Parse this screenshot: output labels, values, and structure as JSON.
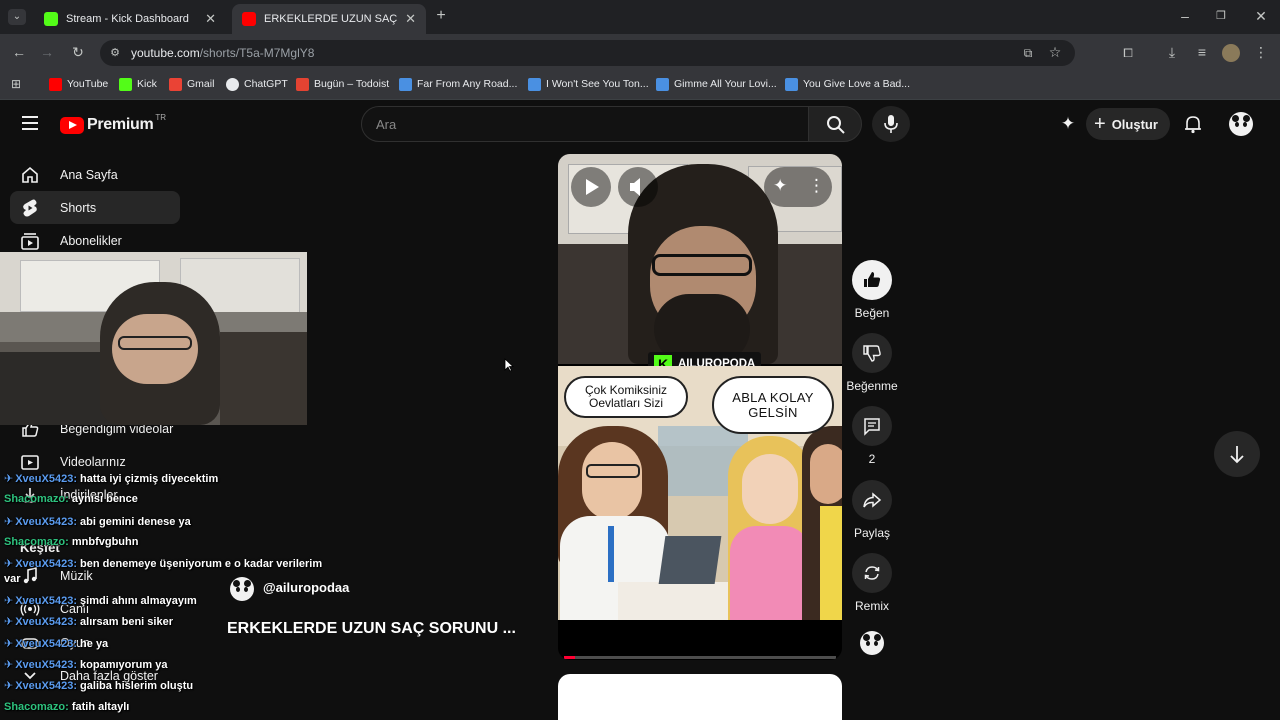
{
  "browser": {
    "tabs": [
      {
        "title": "Stream - Kick Dashboard",
        "favicon_color": "#53fc18"
      },
      {
        "title": "ERKEKLERDE UZUN SAÇ SORUN",
        "favicon_color": "#ff0000"
      }
    ],
    "url": {
      "host": "youtube.com",
      "path": "/shorts/T5a-M7MglY8"
    },
    "bookmarks": [
      {
        "label": "YouTube",
        "color": "#ff0000"
      },
      {
        "label": "Kick",
        "color": "#53fc18"
      },
      {
        "label": "Gmail",
        "color": "#ea4335"
      },
      {
        "label": "ChatGPT",
        "color": "#e8eaed"
      },
      {
        "label": "Bugün – Todoist",
        "color": "#e44332"
      },
      {
        "label": "Far From Any Road...",
        "color": "#4a90e2"
      },
      {
        "label": "I Won't See You Ton...",
        "color": "#4a90e2"
      },
      {
        "label": "Gimme All Your Lovi...",
        "color": "#4a90e2"
      },
      {
        "label": "You Give Love a Bad...",
        "color": "#4a90e2"
      }
    ]
  },
  "youtube": {
    "logo": "Premium",
    "logo_region": "TR",
    "search_placeholder": "Ara",
    "create_label": "Oluştur",
    "sidebar": [
      {
        "label": "Ana Sayfa",
        "icon": "home-icon"
      },
      {
        "label": "Shorts",
        "icon": "shorts-icon"
      },
      {
        "label": "Abonelikler",
        "icon": "subscriptions-icon"
      },
      {
        "label": "Beğendiğim videolar",
        "icon": "like-icon"
      },
      {
        "label": "Videolarınız",
        "icon": "your-videos-icon"
      },
      {
        "label": "İndirilenler",
        "icon": "download-icon"
      },
      {
        "label": "Keşfet",
        "icon": "explore-icon"
      },
      {
        "label": "Müzik",
        "icon": "music-icon"
      },
      {
        "label": "Canlı",
        "icon": "live-icon"
      },
      {
        "label": "Oyun",
        "icon": "gaming-icon"
      },
      {
        "label": "Daha fazla göster",
        "icon": "chevron-down-icon"
      }
    ],
    "short": {
      "channel": "@ailuropodaa",
      "title": "ERKEKLERDE UZUN SAÇ SORUNU ...",
      "overlay_brand": "AILUROPODA",
      "bubble_left": "Çok Komiksiniz Oevlatları Sizi",
      "bubble_right": "ABLA KOLAY GELSİN"
    },
    "actions": {
      "like": "Beğen",
      "dislike": "Beğenme",
      "comments": "2",
      "share": "Paylaş",
      "remix": "Remix"
    }
  },
  "chat": [
    {
      "user": "XveuX5423:",
      "msg": "hatta iyi çizmiş diyecektim",
      "kind": "u1"
    },
    {
      "user": "Shacomazo:",
      "msg": "aynısı bence",
      "kind": "u2"
    },
    {
      "user": "XveuX5423:",
      "msg": "abi gemini denese ya",
      "kind": "u1"
    },
    {
      "user": "Shacomazo:",
      "msg": "mnbfvgbuhn",
      "kind": "u2"
    },
    {
      "user": "XveuX5423:",
      "msg": "ben denemeye üşeniyorum e o kadar verilerim",
      "kind": "u1"
    },
    {
      "user": "",
      "msg": "var",
      "kind": "cont"
    },
    {
      "user": "XveuX5423:",
      "msg": "şimdi ahını almayayım",
      "kind": "u1"
    },
    {
      "user": "XveuX5423:",
      "msg": "alırsam beni siker",
      "kind": "u1"
    },
    {
      "user": "XveuX5423:",
      "msg": "he ya",
      "kind": "u1"
    },
    {
      "user": "XveuX5423:",
      "msg": "kopamıyorum ya",
      "kind": "u1"
    },
    {
      "user": "XveuX5423:",
      "msg": "galiba hislerim oluştu",
      "kind": "u1"
    },
    {
      "user": "Shacomazo:",
      "msg": "fatih altaylı",
      "kind": "u2"
    }
  ]
}
